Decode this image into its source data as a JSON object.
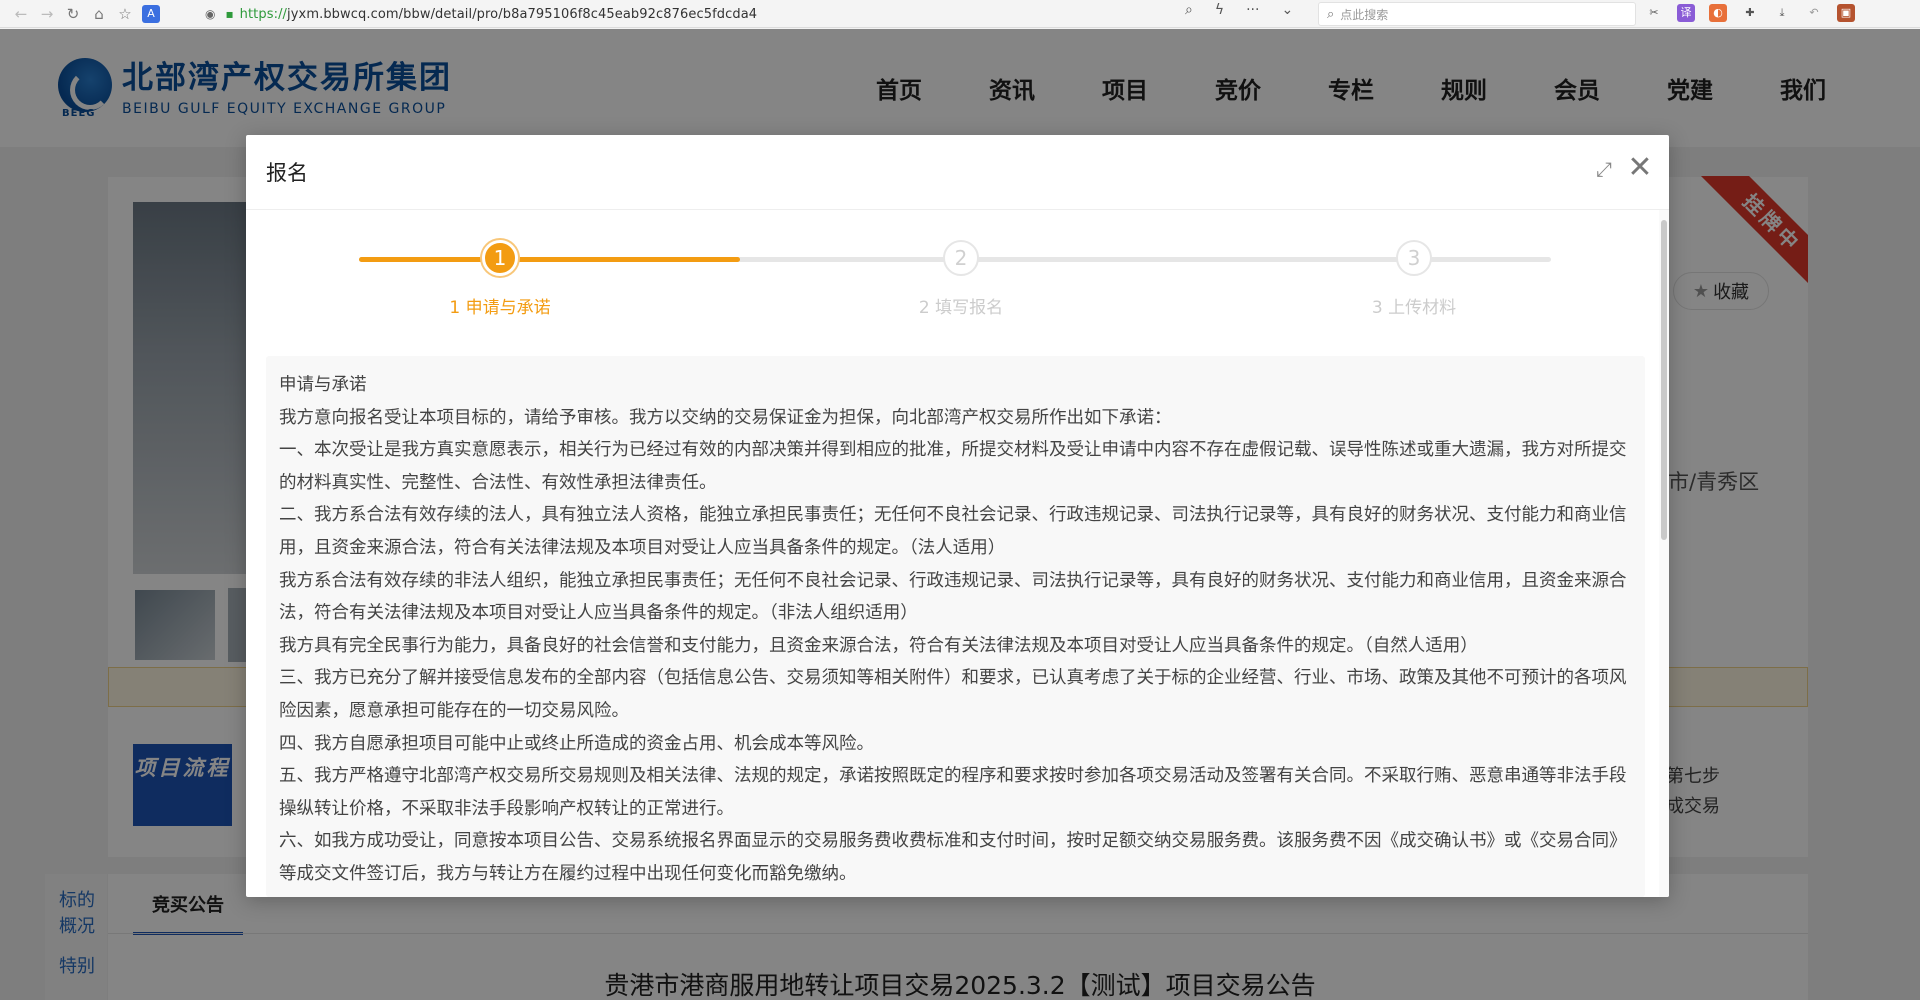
{
  "browser": {
    "url_scheme": "https://",
    "url_rest": "jyxm.bbwcq.com/bbw/detail/pro/b8a795106f8c45eab92c876ec5fdcda4",
    "search_placeholder": "点此搜索"
  },
  "site": {
    "logo_cn": "北部湾产权交易所集团",
    "logo_en": "BEIBU GULF EQUITY EXCHANGE GROUP",
    "logo_abbr": "BEEG",
    "nav": [
      "首页",
      "资讯",
      "项目",
      "竞价",
      "专栏",
      "规则",
      "会员",
      "党建",
      "我们"
    ]
  },
  "background_page": {
    "ribbon": "挂牌中",
    "favorite_label": "收藏",
    "region_fragment": "市/青秀区",
    "flow_badge": "项目流程",
    "flow_step_line1": "第七步",
    "flow_step_line2": "成交易",
    "side_tabs": [
      "标的概况",
      "特别"
    ],
    "content_tab": "竞买公告",
    "announcement_title": "贵港市港商服用地转让项目交易2025.3.2【测试】项目交易公告"
  },
  "modal": {
    "title": "报名",
    "steps": [
      {
        "number": "1",
        "label": "1 申请与承诺",
        "active": true
      },
      {
        "number": "2",
        "label": "2 填写报名",
        "active": false
      },
      {
        "number": "3",
        "label": "3 上传材料",
        "active": false
      }
    ],
    "progress_fraction": 0.32,
    "paragraphs": [
      "申请与承诺",
      "我方意向报名受让本项目标的，请给予审核。我方以交纳的交易保证金为担保，向北部湾产权交易所作出如下承诺：",
      "一、本次受让是我方真实意愿表示，相关行为已经过有效的内部决策并得到相应的批准，所提交材料及受让申请中内容不存在虚假记载、误导性陈述或重大遗漏，我方对所提交的材料真实性、完整性、合法性、有效性承担法律责任。",
      "二、我方系合法有效存续的法人，具有独立法人资格，能独立承担民事责任；无任何不良社会记录、行政违规记录、司法执行记录等，具有良好的财务状况、支付能力和商业信用，且资金来源合法，符合有关法律法规及本项目对受让人应当具备条件的规定。（法人适用）",
      "我方系合法有效存续的非法人组织，能独立承担民事责任；无任何不良社会记录、行政违规记录、司法执行记录等，具有良好的财务状况、支付能力和商业信用，且资金来源合法，符合有关法律法规及本项目对受让人应当具备条件的规定。（非法人组织适用）",
      "我方具有完全民事行为能力，具备良好的社会信誉和支付能力，且资金来源合法，符合有关法律法规及本项目对受让人应当具备条件的规定。（自然人适用）",
      "三、我方已充分了解并接受信息发布的全部内容（包括信息公告、交易须知等相关附件）和要求，已认真考虑了关于标的企业经营、行业、市场、政策及其他不可预计的各项风险因素，愿意承担可能存在的一切交易风险。",
      "四、我方自愿承担项目可能中止或终止所造成的资金占用、机会成本等风险。",
      "五、我方严格遵守北部湾产权交易所交易规则及相关法律、法规的规定，承诺按照既定的程序和要求按时参加各项交易活动及签署有关合同。不采取行贿、恶意串通等非法手段操纵转让价格，不采取非法手段影响产权转让的正常进行。",
      "六、如我方成功受让，同意按本项目公告、交易系统报名界面显示的交易服务费收费标准和支付时间，按时足额交纳交易服务费。该服务费不因《成交确认书》或《交易合同》等成交文件签订后，我方与转让方在履约过程中出现任何变化而豁免缴纳。"
    ]
  }
}
